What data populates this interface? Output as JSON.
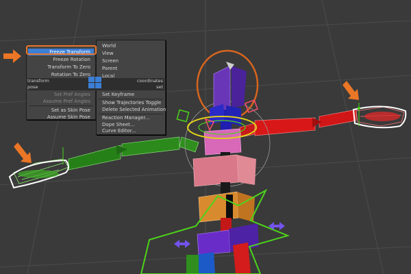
{
  "viewport": {
    "colors": {
      "background": "#3a3a3a",
      "grid": "#4a4a4a",
      "arm_left": "#2e8b1e",
      "arm_right": "#d81818",
      "spine_purple": "#5a2fa8",
      "spine_pink": "#d86888",
      "pelvis_orange": "#d88a2e",
      "selection_green": "#4cd41a",
      "ik_orange": "#d8651e",
      "arrow": "#ea7626"
    }
  },
  "quad_menu": {
    "left_items": [
      {
        "label": "Freeze Transform",
        "selected": true,
        "enabled": true
      },
      {
        "label": "Freeze Rotation",
        "selected": false,
        "enabled": true
      },
      {
        "label": "Transform To Zero",
        "selected": false,
        "enabled": true
      },
      {
        "label": "Rotation To Zero",
        "selected": false,
        "enabled": true
      },
      {
        "label": "Set Pref Angles",
        "selected": false,
        "enabled": false
      },
      {
        "label": "Assume Pref Angles",
        "selected": false,
        "enabled": false
      },
      {
        "label": "Set as Skin Pose",
        "selected": false,
        "enabled": true
      },
      {
        "label": "Assume Skin Pose",
        "selected": false,
        "enabled": true
      }
    ],
    "right_items": [
      {
        "label": "World"
      },
      {
        "label": "View"
      },
      {
        "label": "Screen"
      },
      {
        "label": "Parent"
      },
      {
        "label": "Local"
      },
      {
        "label": "Set Keyframe"
      },
      {
        "label": "Show Trajectories Toggle"
      },
      {
        "label": "Delete Selected Animation"
      },
      {
        "label": "Reaction Manager..."
      },
      {
        "label": "Dope Sheet..."
      },
      {
        "label": "Curve Editor..."
      }
    ],
    "headers": {
      "transform": "transform",
      "coordinates": "coordinates",
      "pose": "pose",
      "set": "set"
    }
  }
}
